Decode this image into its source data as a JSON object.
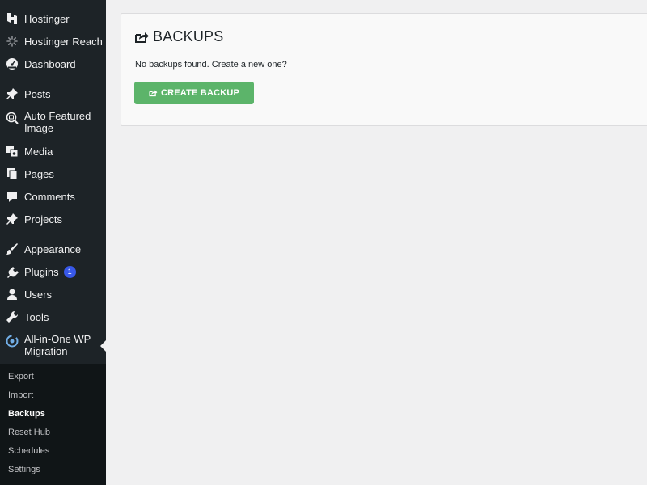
{
  "sidebar": {
    "items": [
      {
        "label": "Hostinger",
        "icon": "hostinger-logo-icon"
      },
      {
        "label": "Hostinger Reach",
        "icon": "reach-spinner-icon"
      },
      {
        "label": "Dashboard",
        "icon": "dashboard-gauge-icon"
      },
      {
        "label": "Posts",
        "icon": "pushpin-icon"
      },
      {
        "label": "Auto Featured Image",
        "icon": "featured-image-icon"
      },
      {
        "label": "Media",
        "icon": "media-icon"
      },
      {
        "label": "Pages",
        "icon": "pages-icon"
      },
      {
        "label": "Comments",
        "icon": "comment-bubble-icon"
      },
      {
        "label": "Projects",
        "icon": "pushpin-icon"
      },
      {
        "label": "Appearance",
        "icon": "paintbrush-icon"
      },
      {
        "label": "Plugins",
        "icon": "plugin-icon",
        "badge": "1"
      },
      {
        "label": "Users",
        "icon": "user-icon"
      },
      {
        "label": "Tools",
        "icon": "wrench-icon"
      },
      {
        "label": "All-in-One WP Migration",
        "icon": "migration-icon",
        "active": true
      }
    ],
    "submenu": [
      {
        "label": "Export"
      },
      {
        "label": "Import"
      },
      {
        "label": "Backups",
        "current": true
      },
      {
        "label": "Reset Hub"
      },
      {
        "label": "Schedules"
      },
      {
        "label": "Settings"
      }
    ]
  },
  "main": {
    "title": "BACKUPS",
    "title_icon": "share-export-icon",
    "empty_message": "No backups found. Create a new one?",
    "create_button": "CREATE BACKUP",
    "create_button_icon": "share-export-icon"
  },
  "colors": {
    "sidebar_bg": "#1d2327",
    "submenu_bg": "#101517",
    "page_bg": "#f0f0f1",
    "button_green": "#5cb46a",
    "badge_blue": "#3858e9"
  }
}
